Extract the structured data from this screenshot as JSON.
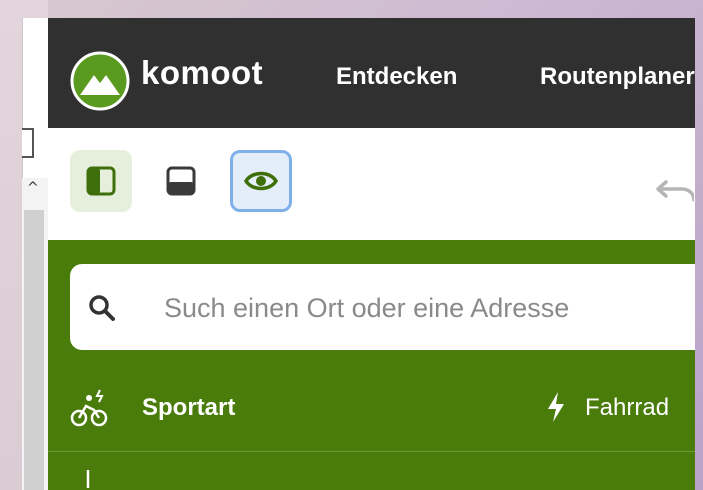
{
  "header": {
    "brand": "komoot",
    "nav": [
      "Entdecken",
      "Routenplaner"
    ]
  },
  "toolbar": {
    "buttons": [
      "panel-left-icon",
      "panel-bottom-icon",
      "eye-icon"
    ],
    "undo_icon": "undo-icon"
  },
  "search": {
    "placeholder": "Such einen Ort oder eine Adresse"
  },
  "sport": {
    "label": "Sportart",
    "value": "Fahrrad"
  },
  "colors": {
    "topbar": "#303030",
    "brand_green": "#4a7c0b",
    "logo_green": "#5a9a1e",
    "selected_blue": "#7fb0ea"
  }
}
